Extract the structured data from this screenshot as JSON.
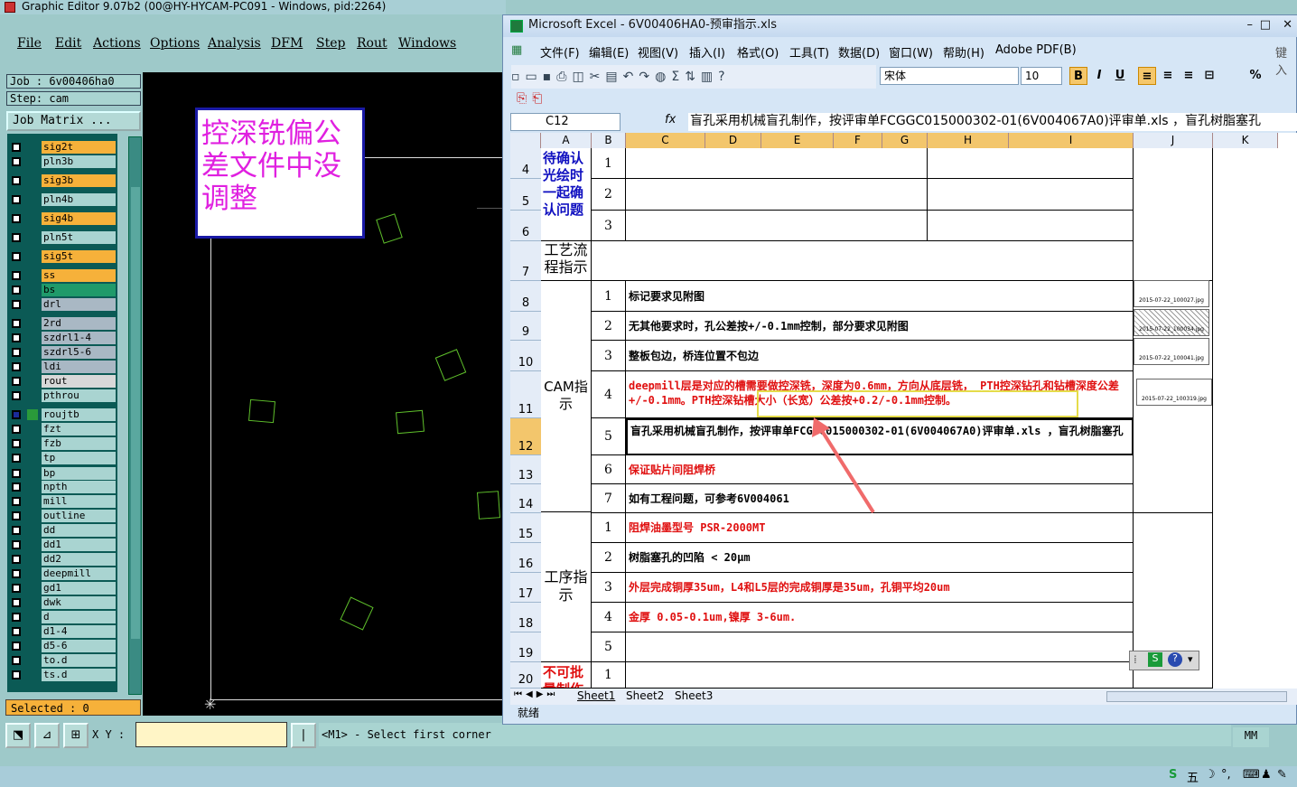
{
  "editor": {
    "title": "Graphic Editor 9.07b2 (00@HY-HYCAM-PC091 - Windows, pid:2264)",
    "menu": [
      "File",
      "Edit",
      "Actions",
      "Options",
      "Analysis",
      "DFM",
      "Step",
      "Rout",
      "Windows"
    ],
    "job": "Job  :  6v00406ha0",
    "step": "Step:  cam",
    "job_matrix": "Job Matrix ...",
    "layers": [
      {
        "name": "sig2t",
        "color": "#f6b13a"
      },
      {
        "name": "pln3b",
        "color": "#a9d4d1"
      },
      {
        "name": "sig3b",
        "color": "#f6b13a"
      },
      {
        "name": "pln4b",
        "color": "#a9d4d1"
      },
      {
        "name": "sig4b",
        "color": "#f6b13a"
      },
      {
        "name": "pln5t",
        "color": "#a9d4d1"
      },
      {
        "name": "sig5t",
        "color": "#f6b13a"
      },
      {
        "name": "ss",
        "color": "#f6b13a"
      },
      {
        "name": "bs",
        "color": "#1f9a6a"
      },
      {
        "name": "drl",
        "color": "#a9b8c4"
      },
      {
        "name": "2rd",
        "color": "#a9b8c4"
      },
      {
        "name": "szdrl1-4",
        "color": "#a9b8c4"
      },
      {
        "name": "szdrl5-6",
        "color": "#a9b8c4"
      },
      {
        "name": "ldi",
        "color": "#a9b8c4"
      },
      {
        "name": "rout",
        "color": "#d8d8d8"
      },
      {
        "name": "pthrou",
        "color": "#a9d4d1"
      },
      {
        "name": "roujtb",
        "color": "#a9d4d1"
      },
      {
        "name": "fzt",
        "color": "#a9d4d1"
      },
      {
        "name": "fzb",
        "color": "#a9d4d1"
      },
      {
        "name": "tp",
        "color": "#a9d4d1"
      },
      {
        "name": "bp",
        "color": "#a9d4d1"
      },
      {
        "name": "npth",
        "color": "#a9d4d1"
      },
      {
        "name": "mill",
        "color": "#a9d4d1"
      },
      {
        "name": "outline",
        "color": "#a9d4d1"
      },
      {
        "name": "dd",
        "color": "#a9d4d1"
      },
      {
        "name": "dd1",
        "color": "#a9d4d1"
      },
      {
        "name": "dd2",
        "color": "#a9d4d1"
      },
      {
        "name": "deepmill",
        "color": "#a9d4d1"
      },
      {
        "name": "gd1",
        "color": "#a9d4d1"
      },
      {
        "name": "dwk",
        "color": "#a9d4d1"
      },
      {
        "name": "d",
        "color": "#a9d4d1"
      },
      {
        "name": "d1-4",
        "color": "#a9d4d1"
      },
      {
        "name": "d5-6",
        "color": "#a9d4d1"
      },
      {
        "name": "to.d",
        "color": "#a9d4d1"
      },
      {
        "name": "ts.d",
        "color": "#a9d4d1"
      }
    ],
    "selected": "Selected : 0",
    "xy_label": "X Y :",
    "prompt": "<M1> - Select first corner",
    "units": "MM",
    "note": "控深铣偏公差文件中没调整"
  },
  "excel": {
    "title": "Microsoft Excel - 6V00406HA0-预审指示.xls",
    "menu": [
      "文件(F)",
      "编辑(E)",
      "视图(V)",
      "插入(I)",
      "格式(O)",
      "工具(T)",
      "数据(D)",
      "窗口(W)",
      "帮助(H)",
      "Adobe PDF(B)"
    ],
    "ask_box": "键入",
    "font": "宋体",
    "size": "10",
    "name_box": "C12",
    "formula": "盲孔采用机械盲孔制作，按评审单FCGGC015000302-01(6V004067A0)评审单.xls ，盲孔树脂塞孔",
    "columns": [
      "A",
      "B",
      "C",
      "D",
      "E",
      "F",
      "G",
      "H",
      "I",
      "J",
      "K"
    ],
    "rows": [
      "4",
      "5",
      "6",
      "7",
      "8",
      "9",
      "10",
      "11",
      "12",
      "13",
      "14",
      "15",
      "16",
      "17",
      "18",
      "19",
      "20"
    ],
    "section_confirm": "待确认光绘时一起确认问题",
    "section_process": "工艺流程指示",
    "section_cam": "CAM指示",
    "section_op": "工序指示",
    "section_no": "不可批量制作",
    "nums": [
      "1",
      "2",
      "3",
      "1",
      "2",
      "3",
      "4",
      "5",
      "6",
      "7",
      "1",
      "2",
      "3",
      "4",
      "5",
      "1"
    ],
    "cam_lines": [
      "标记要求见附图",
      "无其他要求时，孔公差按+/-0.1mm控制，部分要求见附图",
      "整板包边，桥连位置不包边",
      "deepmill层是对应的槽需要做控深铣，深度为0.6mm，方向从底层铣， PTH控深钻孔和钻槽深度公差+/-0.1mm。PTH控深钻槽大小（长宽）公差按+0.2/-0.1mm控制。",
      "盲孔采用机械盲孔制作，按评审单FCGGC015000302-01(6V004067A0)评审单.xls ，盲孔树脂塞孔",
      "保证贴片间阻焊桥",
      "如有工程问题，可参考6V004061"
    ],
    "op_lines": [
      "阻焊油墨型号 PSR-2000MT",
      "树脂塞孔的凹陷 < 20μm",
      "外层完成铜厚35um，L4和L5层的完成铜厚是35um，孔铜平均20um",
      "金厚 0.05-0.1um,镍厚 3-6um."
    ],
    "thumbs": [
      "2015-07-22_100027.jpg",
      "2015-07-22_100034.jpg",
      "2015-07-22_100041.jpg",
      "2015-07-22_100319.jpg"
    ],
    "sheets": [
      "Sheet1",
      "Sheet2",
      "Sheet3"
    ],
    "status": "就绪"
  },
  "colors": {
    "highlight": "#e5dc4a",
    "arrow": "#f06b6b",
    "red_text": "#e01010"
  }
}
